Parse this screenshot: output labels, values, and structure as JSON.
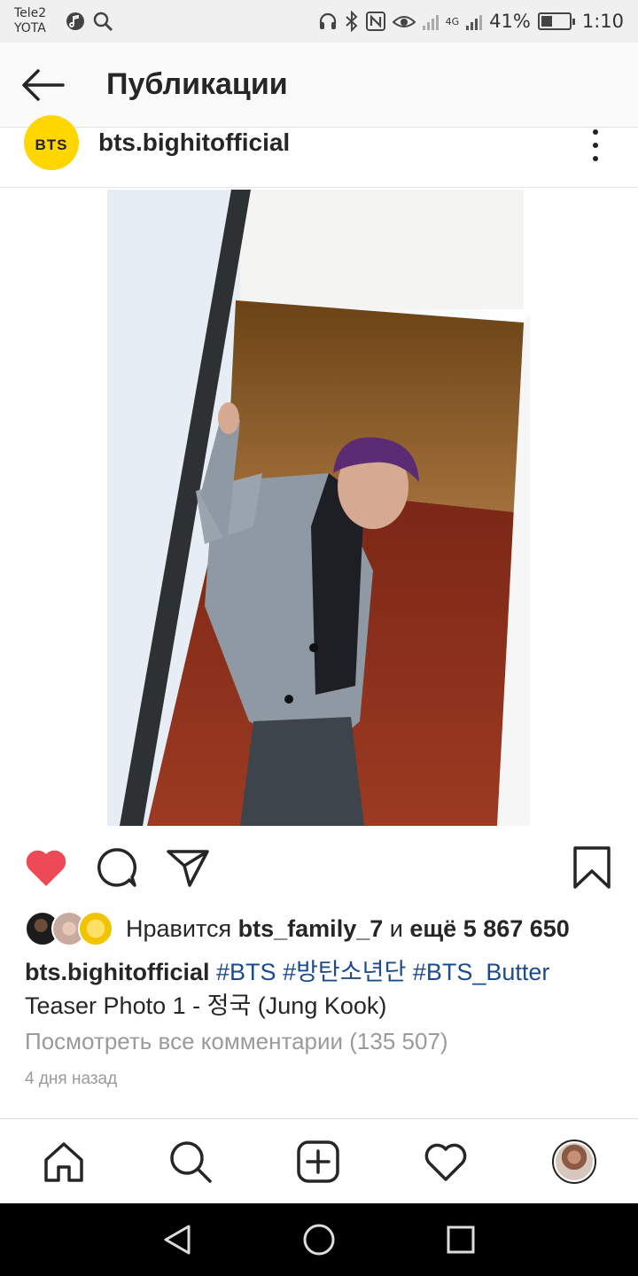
{
  "status_bar": {
    "carrier_1": "Tele2",
    "carrier_2": "YOTA",
    "network": "4G",
    "battery": "41%",
    "battery_level": 0.41,
    "time": "1:10"
  },
  "header": {
    "title": "Публикации",
    "back_icon": "arrow-left-icon"
  },
  "post": {
    "avatar_text": "BTS",
    "username": "bts.bighitofficial",
    "more_icon": "more-vertical-icon",
    "liked": true,
    "likes_prefix": "Нравится",
    "likes_user": "bts_family_7",
    "likes_connector": "и",
    "likes_rest": "ещё 5 867 650",
    "caption_user": "bts.bighitofficial",
    "hashtags": [
      "#BTS",
      "#방탄소년단",
      "#BTS_Butter"
    ],
    "caption_text": "Teaser Photo 1 - 정국 (Jung Kook)",
    "view_comments": "Посмотреть все комментарии (135 507)",
    "time_ago": "4 дня назад"
  },
  "colors": {
    "like_red": "#ed4956",
    "hashtag_blue": "#1d4c8c",
    "avatar_yellow": "#ffd600"
  },
  "bottom_nav": [
    "home-icon",
    "search-icon",
    "add-post-icon",
    "activity-heart-icon",
    "profile-avatar"
  ],
  "system_nav": [
    "back-triangle-icon",
    "home-circle-icon",
    "recents-square-icon"
  ]
}
